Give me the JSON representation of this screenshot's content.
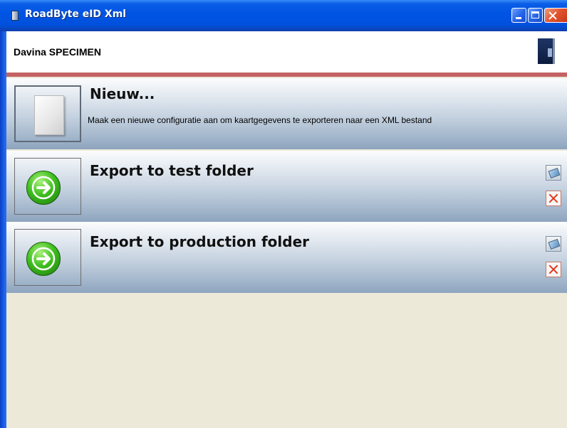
{
  "window": {
    "title": "RoadByte eID Xml"
  },
  "header": {
    "user_name": "Davina SPECIMEN"
  },
  "configurations": [
    {
      "title": "Nieuw...",
      "description": "Maak een nieuwe configuratie aan om kaartgegevens te exporteren naar een XML bestand",
      "icon": "blank-document-icon"
    },
    {
      "title": "Export to test folder",
      "icon": "green-arrow-right-icon"
    },
    {
      "title": "Export to production folder",
      "icon": "green-arrow-right-icon"
    }
  ],
  "colors": {
    "titlebar": "#0054e3",
    "divider": "#c46363",
    "background": "#ece9d8"
  }
}
